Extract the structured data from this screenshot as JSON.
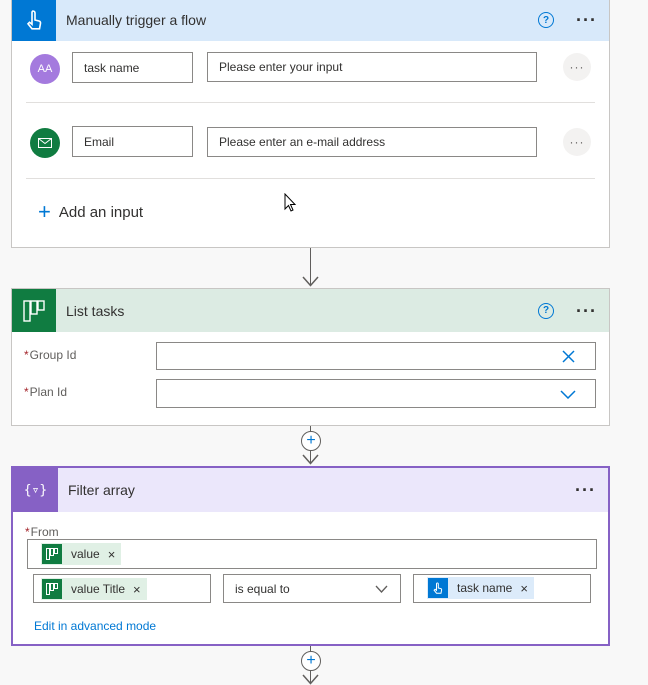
{
  "trigger": {
    "title": "Manually trigger a flow",
    "help_icon": "?",
    "more_icon": "···",
    "inputs": [
      {
        "icon_text": "AA",
        "icon_color": "#a47ade",
        "name": "task name",
        "value_placeholder": "Please enter your input"
      },
      {
        "icon_text": "✉",
        "icon_color": "#107c41",
        "name": "Email",
        "value_placeholder": "Please enter an e-mail address"
      }
    ],
    "add_input_label": "Add an input",
    "header_color": "#d8e9fa",
    "icon_bg": "#0078d4"
  },
  "list_tasks": {
    "title": "List tasks",
    "help_icon": "?",
    "more_icon": "···",
    "header_color": "#dcebe3",
    "icon_bg": "#107c41",
    "fields": [
      {
        "label": "Group Id",
        "value": "",
        "control": "clear-icon"
      },
      {
        "label": "Plan Id",
        "value": "",
        "control": "chevron-down-icon"
      }
    ]
  },
  "filter_array": {
    "title": "Filter array",
    "more_icon": "···",
    "header_color": "#ebe7fb",
    "icon_bg": "#8661c5",
    "from_label": "From",
    "from_token": "value",
    "left_token": "value Title",
    "operator": "is equal to",
    "right_token": "task name",
    "advanced_link": "Edit in advanced mode"
  },
  "connector_plus": "+",
  "token_remove": "×"
}
